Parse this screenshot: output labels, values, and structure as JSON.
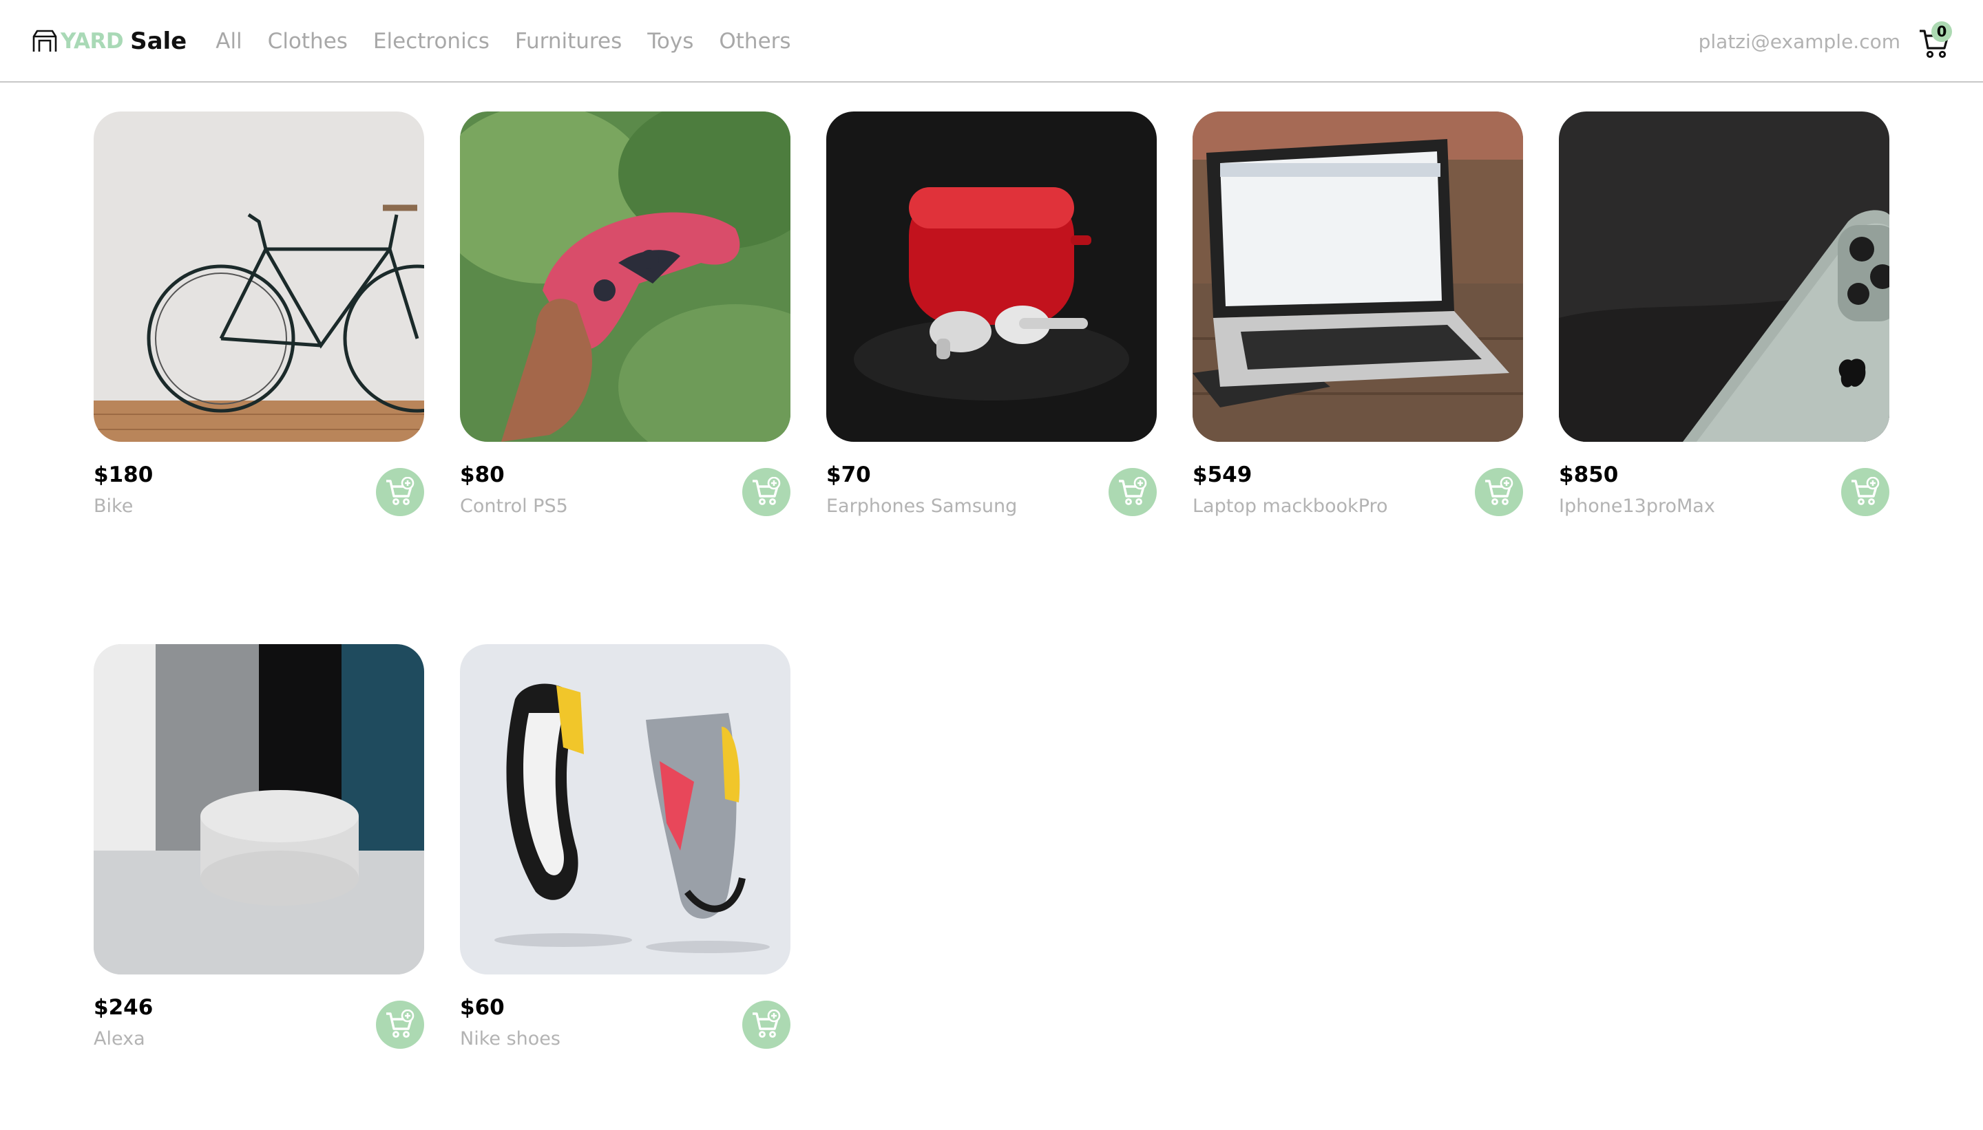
{
  "brand": {
    "accent": "YARD",
    "main": "Sale"
  },
  "nav": {
    "categories": [
      "All",
      "Clothes",
      "Electronics",
      "Furnitures",
      "Toys",
      "Others"
    ]
  },
  "account": {
    "email": "platzi@example.com"
  },
  "cart": {
    "count": "0"
  },
  "colors": {
    "accent_green": "#acd9b2",
    "muted_text": "#b3b3b3"
  },
  "products": [
    {
      "price": "$180",
      "name": "Bike",
      "image": "bicycle-photo"
    },
    {
      "price": "$80",
      "name": "Control PS5",
      "image": "gamepad-photo"
    },
    {
      "price": "$70",
      "name": "Earphones Samsung",
      "image": "earbuds-photo"
    },
    {
      "price": "$549",
      "name": "Laptop mackbookPro",
      "image": "laptop-photo"
    },
    {
      "price": "$850",
      "name": "Iphone13proMax",
      "image": "phone-photo"
    },
    {
      "price": "$246",
      "name": "Alexa",
      "image": "smart-speaker-photo"
    },
    {
      "price": "$60",
      "name": "Nike shoes",
      "image": "sneakers-photo"
    }
  ]
}
